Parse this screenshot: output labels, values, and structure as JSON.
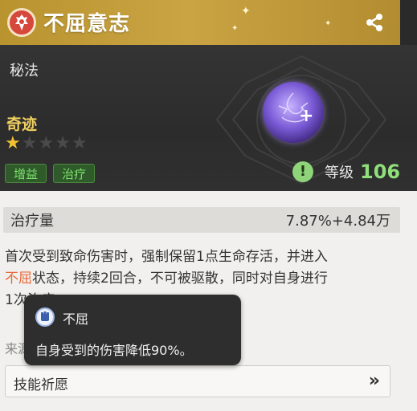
{
  "header": {
    "title": "不屈意志",
    "icon": "cross-emblem-icon",
    "share_icon": "share-icon"
  },
  "banner": {
    "type_label": "秘法",
    "rarity_label": "奇迹",
    "stars_filled": 1,
    "stars_total": 5,
    "tags": [
      "增益",
      "治疗"
    ],
    "level_label": "等级",
    "level_value": "106",
    "alert_symbol": "!"
  },
  "stat": {
    "name": "治疗量",
    "value": "7.87%+4.84万"
  },
  "description": {
    "line1": "首次受到致命伤害时，强制保留1点生命存活，并进入",
    "highlight": "不屈",
    "line2_rest": "状态，持续2回合，不可被驱散，同时对自身进行",
    "line3": "1次治疗。"
  },
  "source_label": "来源",
  "action": {
    "label": "技能祈愿",
    "arrow": "»"
  },
  "tooltip": {
    "title": "不屈",
    "body": "自身受到的伤害降低90%。"
  },
  "colors": {
    "header_gold": "#caa443",
    "banner_dark": "#2e2e2e",
    "tag_green": "#7fe26e",
    "level_green": "#8fe07a",
    "star_gold": "#f2c230",
    "highlight_orange": "#e66a3b"
  }
}
